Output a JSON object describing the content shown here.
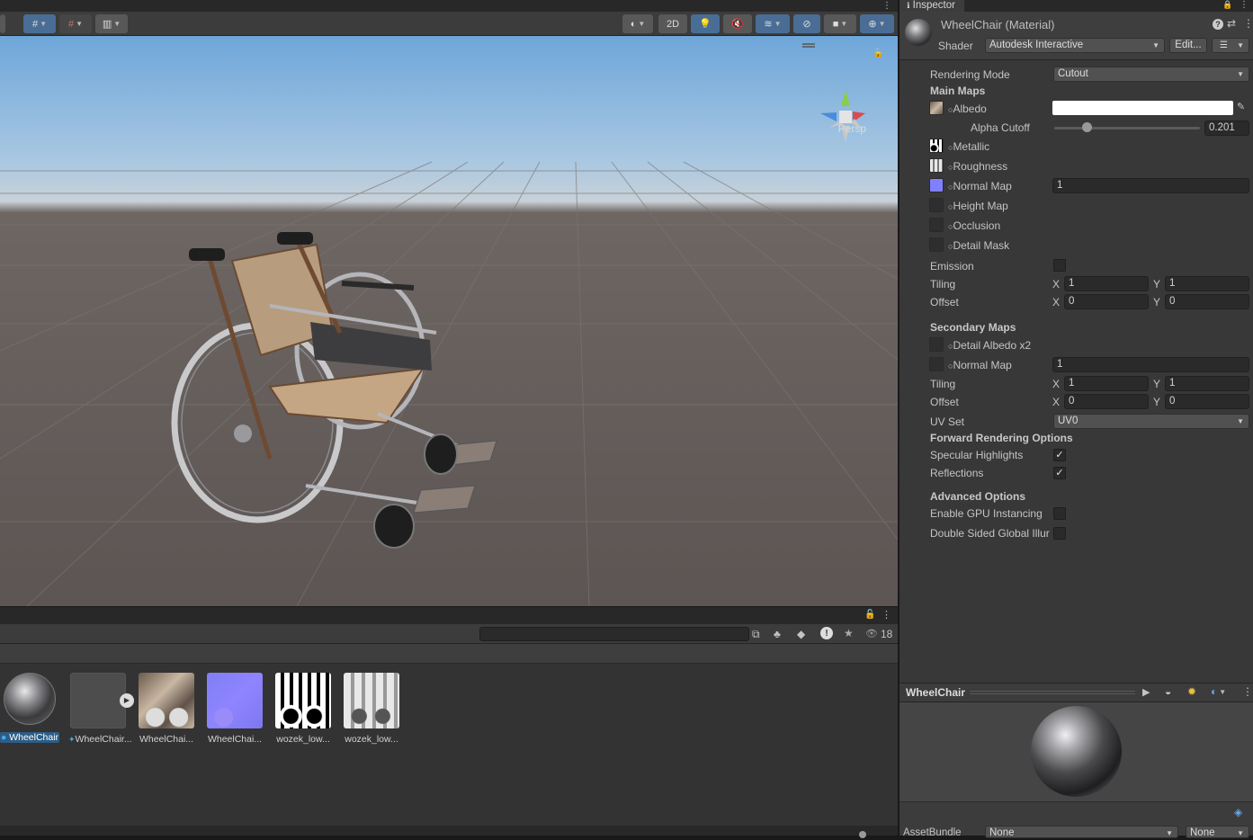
{
  "scene": {
    "toolbar": {
      "mode_2d_label": "2D"
    },
    "persp_label": "Persp"
  },
  "project": {
    "search": {
      "value": "",
      "placeholder": ""
    },
    "hidden_count": "18",
    "assets": [
      {
        "label": "WheelChair",
        "type": "material"
      },
      {
        "label": "WheelChair...",
        "type": "model"
      },
      {
        "label": "WheelChai...",
        "type": "texture-albedo"
      },
      {
        "label": "WheelChai...",
        "type": "texture-normal"
      },
      {
        "label": "wozek_low...",
        "type": "texture-mask"
      },
      {
        "label": "wozek_low...",
        "type": "texture-roughness"
      }
    ]
  },
  "inspector": {
    "tab_label": "Inspector",
    "material_name": "WheelChair (Material)",
    "shader_label": "Shader",
    "shader_value": "Autodesk Interactive",
    "edit_label": "Edit...",
    "rendering_mode_label": "Rendering Mode",
    "rendering_mode_value": "Cutout",
    "main_maps_header": "Main Maps",
    "albedo_label": "Albedo",
    "albedo_color": "#ffffff",
    "alpha_cutoff_label": "Alpha Cutoff",
    "alpha_cutoff_value": "0.201",
    "metallic_label": "Metallic",
    "roughness_label": "Roughness",
    "normal_map_label": "Normal Map",
    "normal_map_value": "1",
    "height_map_label": "Height Map",
    "occlusion_label": "Occlusion",
    "detail_mask_label": "Detail Mask",
    "emission_label": "Emission",
    "tiling_label": "Tiling",
    "offset_label": "Offset",
    "x_label": "X",
    "y_label": "Y",
    "main_tiling_x": "1",
    "main_tiling_y": "1",
    "main_offset_x": "0",
    "main_offset_y": "0",
    "secondary_maps_header": "Secondary Maps",
    "detail_albedo_label": "Detail Albedo x2",
    "sec_normal_map_label": "Normal Map",
    "sec_normal_map_value": "1",
    "sec_tiling_x": "1",
    "sec_tiling_y": "1",
    "sec_offset_x": "0",
    "sec_offset_y": "0",
    "uv_set_label": "UV Set",
    "uv_set_value": "UV0",
    "forward_header": "Forward Rendering Options",
    "specular_label": "Specular Highlights",
    "specular_checked": true,
    "reflections_label": "Reflections",
    "reflections_checked": true,
    "advanced_header": "Advanced Options",
    "gpu_instancing_label": "Enable GPU Instancing",
    "gpu_instancing_checked": false,
    "double_sided_label": "Double Sided Global Illur",
    "double_sided_checked": false
  },
  "preview": {
    "title": "WheelChair"
  },
  "assetbundle": {
    "label": "AssetBundle",
    "name_value": "None",
    "variant_value": "None"
  },
  "colors": {
    "accent": "#4a6d96",
    "normal_map_swatch": "#8080ff",
    "selection": "#2c5d87"
  }
}
